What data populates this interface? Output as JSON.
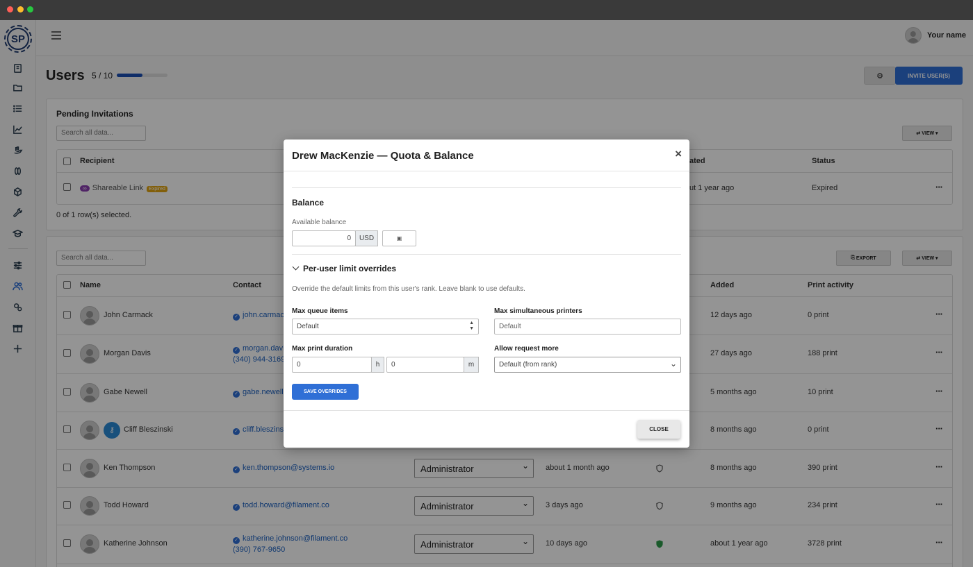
{
  "window": {
    "dots": [
      "#ff5f57",
      "#febc2e",
      "#28c840"
    ]
  },
  "brand": {
    "logo_text": "SP"
  },
  "sidebar": {
    "icons": [
      "book-icon",
      "folder-icon",
      "list-icon",
      "chart-icon",
      "hand-icon",
      "filament-icon",
      "cube-icon",
      "wrench-icon",
      "graduation-cap-icon",
      "sliders-icon",
      "users-icon",
      "gears-icon",
      "gift-icon",
      "plus-icon"
    ]
  },
  "topbar": {
    "user_name": "Your name"
  },
  "page": {
    "title": "Users",
    "quota": "5 / 10",
    "quota_fraction": 0.5,
    "invite_label": "INVITE USER(S)"
  },
  "pending": {
    "title": "Pending Invitations",
    "search_placeholder": "Search all data...",
    "view_label": "VIEW",
    "columns": {
      "recipient": "Recipient",
      "created": "ated",
      "status": "Status"
    },
    "row": {
      "recipient": "Shareable Link",
      "badge": "Expired",
      "created": "ut 1 year ago",
      "status": "Expired"
    },
    "footer": "0 of 1 row(s) selected."
  },
  "users": {
    "search_placeholder": "Search all data...",
    "export_label": "EXPORT",
    "view_label": "VIEW",
    "columns": {
      "name": "Name",
      "contact": "Contact",
      "added": "Added",
      "activity": "Print activity"
    },
    "rows": [
      {
        "name": "John Carmack",
        "email": "john.carmac",
        "phone": "",
        "role": "",
        "last_seen": "",
        "added": "12 days ago",
        "activity": "0 print"
      },
      {
        "name": "Morgan Davis",
        "email": "morgan.davi",
        "phone": "(340) 944-3169",
        "role": "",
        "last_seen": "",
        "added": "27 days ago",
        "activity": "188 print"
      },
      {
        "name": "Gabe Newell",
        "email": "gabe.newell@",
        "phone": "",
        "role": "",
        "last_seen": "",
        "added": "5 months ago",
        "activity": "10 print"
      },
      {
        "name": "Cliff Bleszinski",
        "email": "cliff.bleszins",
        "phone": "",
        "role": "",
        "last_seen": "",
        "added": "8 months ago",
        "activity": "0 print"
      },
      {
        "name": "Ken Thompson",
        "email": "ken.thompson@systems.io",
        "phone": "",
        "role": "Administrator",
        "last_seen": "about 1 month ago",
        "added": "8 months ago",
        "activity": "390 print"
      },
      {
        "name": "Todd Howard",
        "email": "todd.howard@filament.co",
        "phone": "",
        "role": "Administrator",
        "last_seen": "3 days ago",
        "added": "9 months ago",
        "activity": "234 print"
      },
      {
        "name": "Katherine Johnson",
        "email": "katherine.johnson@filament.co",
        "phone": "(390) 767-9650",
        "role": "Administrator",
        "last_seen": "10 days ago",
        "added": "about 1 year ago",
        "activity": "3728 print"
      }
    ]
  },
  "modal": {
    "title": "Drew MacKenzie — Quota & Balance",
    "balance_title": "Balance",
    "available_label": "Available balance",
    "balance_value": "0",
    "currency": "USD",
    "overrides_title": "Per-user limit overrides",
    "overrides_help": "Override the default limits from this user's rank. Leave blank to use defaults.",
    "max_queue_label": "Max queue items",
    "max_queue_value": "Default",
    "max_printers_label": "Max simultaneous printers",
    "max_printers_placeholder": "Default",
    "max_duration_label": "Max print duration",
    "hours_value": "0",
    "hours_unit": "h",
    "minutes_value": "0",
    "minutes_unit": "m",
    "allow_more_label": "Allow request more",
    "allow_more_value": "Default (from rank)",
    "save_label": "SAVE OVERRIDES",
    "close_label": "CLOSE"
  }
}
